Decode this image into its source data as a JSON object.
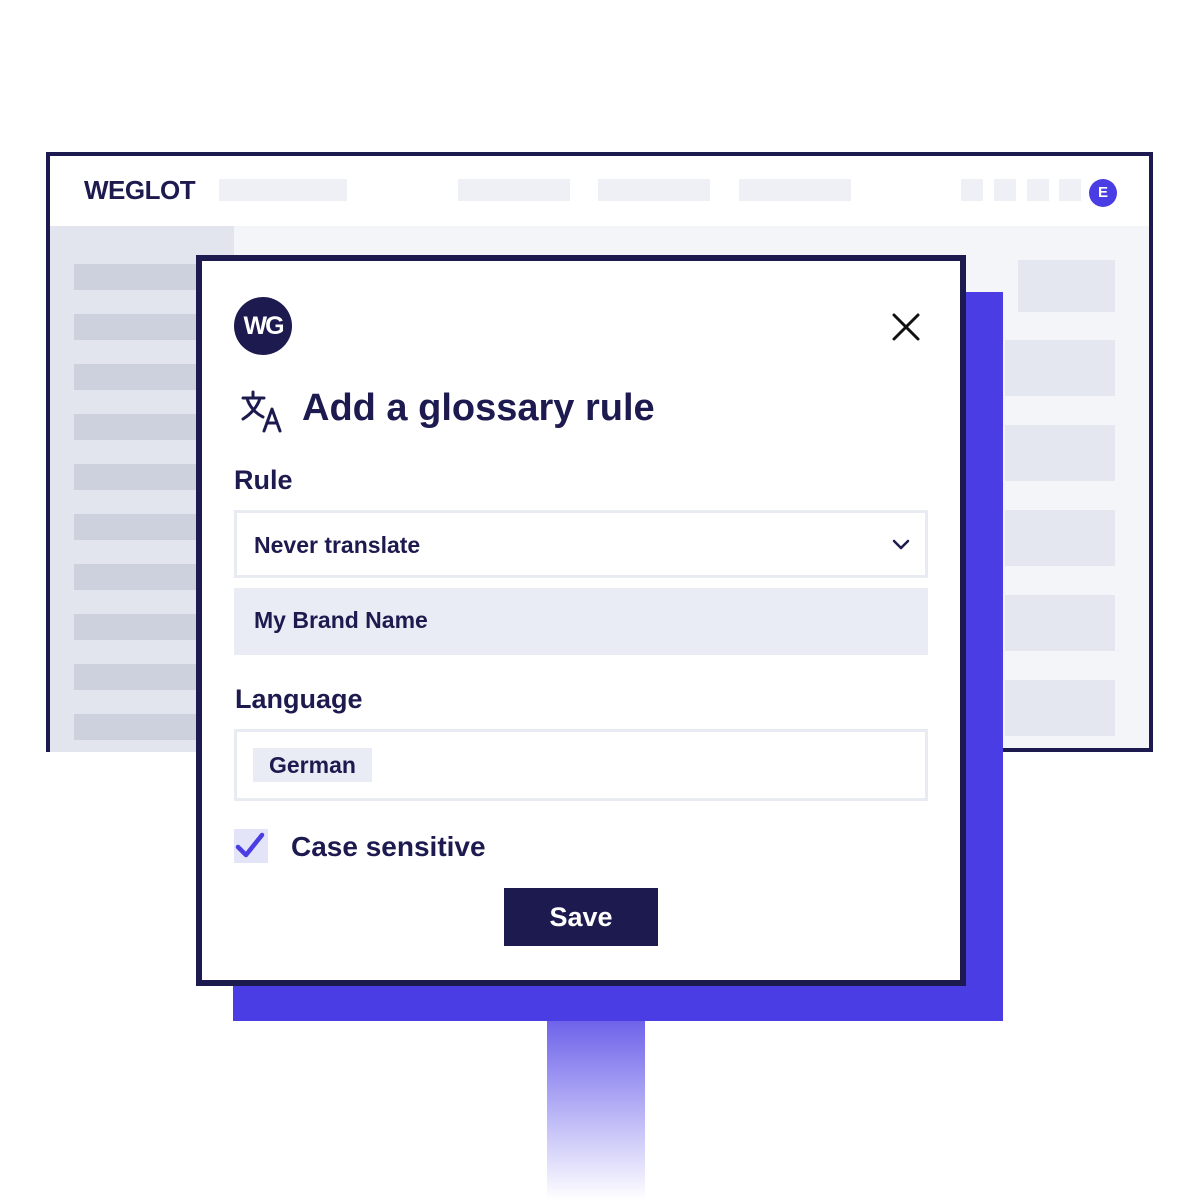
{
  "app": {
    "brand": "WEGLOT",
    "avatar_initial": "E"
  },
  "modal": {
    "logo_text": "WG",
    "title": "Add a glossary rule",
    "rule_label": "Rule",
    "rule_selected": "Never translate",
    "term_value": "My Brand Name",
    "language_label": "Language",
    "language_chip": "German",
    "case_sensitive_label": "Case sensitive",
    "case_sensitive_checked": true,
    "save_label": "Save"
  },
  "colors": {
    "navy": "#1d1a4f",
    "accent": "#4a3de3",
    "field_bg": "#e9ecf4"
  },
  "icons": [
    "translate-icon",
    "close-icon",
    "chevron-down-icon",
    "check-icon"
  ]
}
